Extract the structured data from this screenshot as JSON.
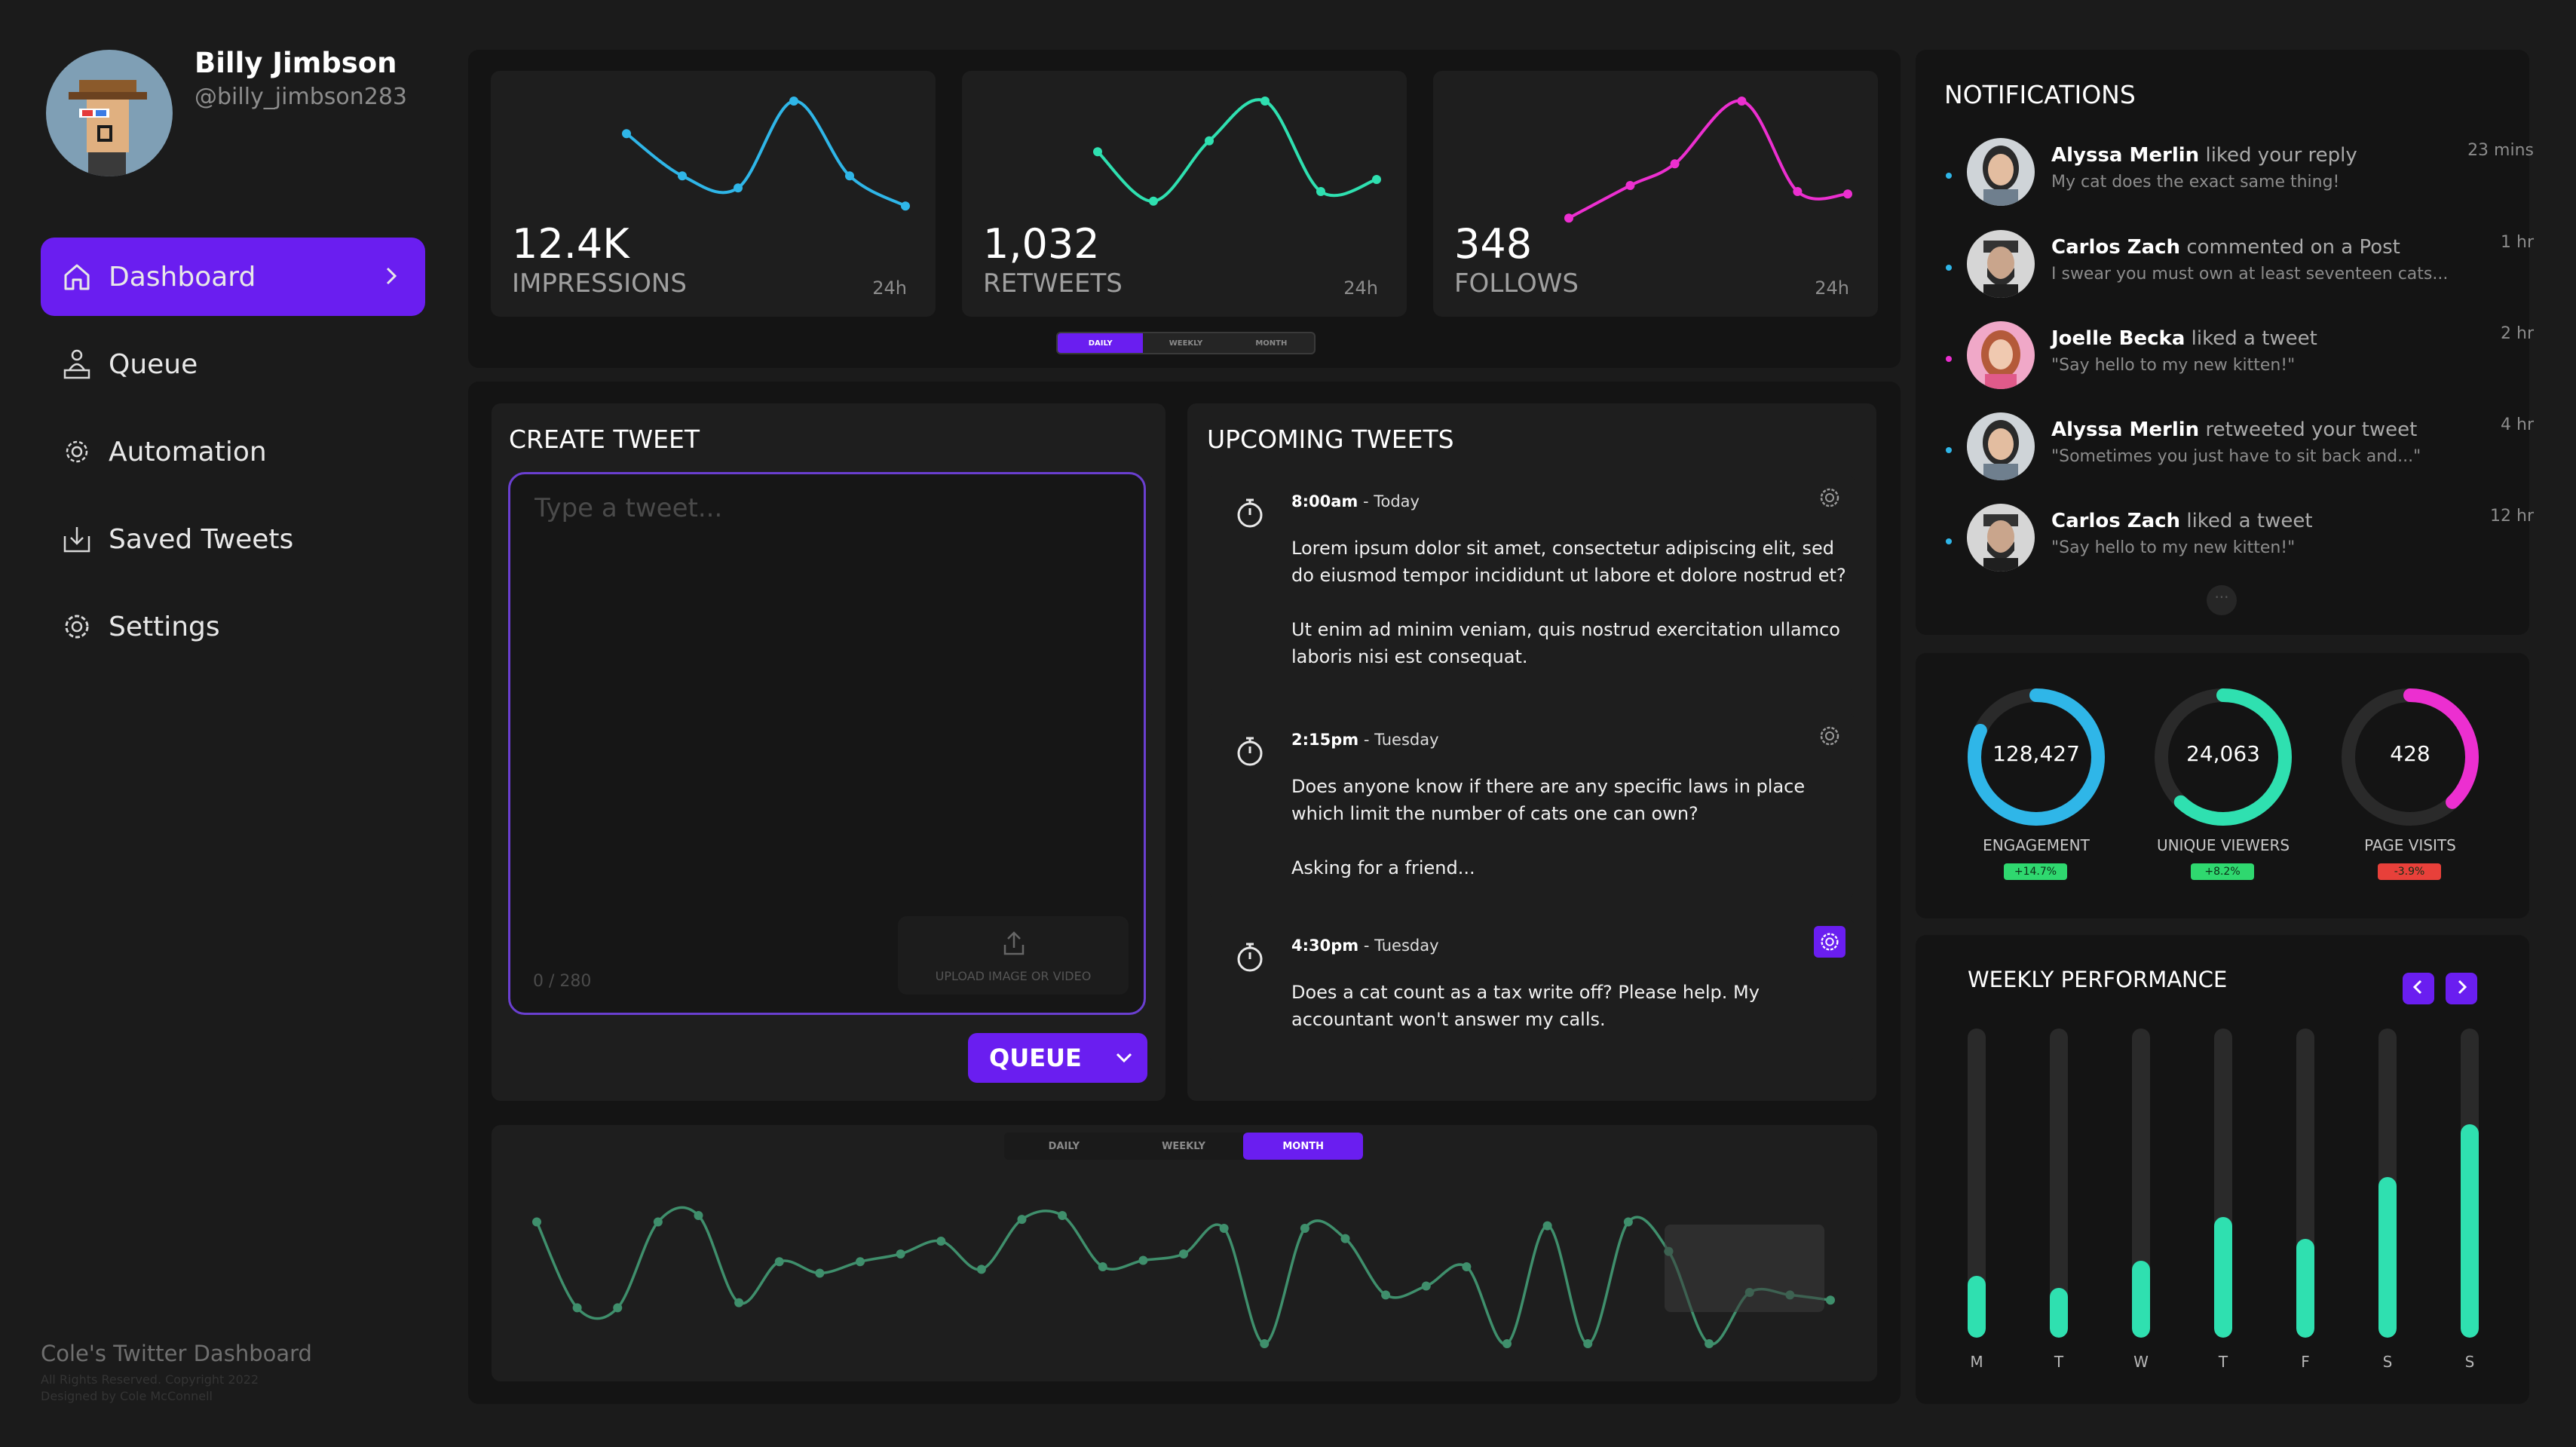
{
  "profile": {
    "name": "Billy Jimbson",
    "handle": "@billy_jimbson283"
  },
  "nav": {
    "items": [
      {
        "label": "Dashboard",
        "icon": "home-icon",
        "active": true
      },
      {
        "label": "Queue",
        "icon": "queue-person-icon"
      },
      {
        "label": "Automation",
        "icon": "automation-gear-icon"
      },
      {
        "label": "Saved Tweets",
        "icon": "download-tray-icon"
      },
      {
        "label": "Settings",
        "icon": "gear-icon"
      }
    ]
  },
  "footer": {
    "title": "Cole's Twitter Dashboard",
    "rights": "All Rights Reserved. Copyright 2022",
    "designer": "Designed by Cole McConnell"
  },
  "stats": [
    {
      "value": "12.4K",
      "label": "IMPRESSIONS",
      "period": "24h",
      "color": "#2fb6e8",
      "points": [
        [
          0.0,
          0.27
        ],
        [
          0.2,
          0.62
        ],
        [
          0.4,
          0.72
        ],
        [
          0.6,
          0.0
        ],
        [
          0.8,
          0.62
        ],
        [
          1.0,
          0.87
        ]
      ]
    },
    {
      "value": "1,032",
      "label": "RETWEETS",
      "period": "24h",
      "color": "#2fe0b0",
      "points": [
        [
          0.0,
          0.42
        ],
        [
          0.2,
          0.83
        ],
        [
          0.4,
          0.33
        ],
        [
          0.6,
          0.0
        ],
        [
          0.8,
          0.75
        ],
        [
          1.0,
          0.65
        ]
      ]
    },
    {
      "value": "348",
      "label": "FOLLOWS",
      "period": "24h",
      "color": "#ec2fd0",
      "points": [
        [
          0.0,
          0.97
        ],
        [
          0.22,
          0.7
        ],
        [
          0.38,
          0.52
        ],
        [
          0.62,
          0.0
        ],
        [
          0.82,
          0.75
        ],
        [
          1.0,
          0.77
        ]
      ]
    }
  ],
  "stats_tabs": {
    "items": [
      "DAILY",
      "WEEKLY",
      "MONTH"
    ],
    "active": 0
  },
  "create_tweet": {
    "title": "CREATE TWEET",
    "placeholder": "Type a tweet...",
    "char_count": "0 / 280",
    "upload_label": "UPLOAD IMAGE OR VIDEO",
    "queue_label": "QUEUE"
  },
  "upcoming": {
    "title": "UPCOMING TWEETS",
    "tweets": [
      {
        "time": "8:00am",
        "day": " - Today",
        "paragraphs": [
          "Lorem ipsum dolor sit amet, consectetur adipiscing elit, sed do eiusmod tempor incididunt ut labore et dolore nostrud et?",
          "Ut enim ad minim veniam, quis nostrud exercitation ullamco laboris nisi est consequat."
        ]
      },
      {
        "time": "2:15pm",
        "day": " - Tuesday",
        "paragraphs": [
          "Does anyone know if there are any specific laws in place which limit the number of cats one can own?",
          "Asking for a friend..."
        ]
      },
      {
        "time": "4:30pm",
        "day": " - Tuesday",
        "paragraphs": [
          "Does a cat count as a tax write off? Please help. My accountant won't answer my calls."
        ]
      }
    ]
  },
  "timeline": {
    "tabs": [
      "DAILY",
      "WEEKLY",
      "MONTH"
    ],
    "active": 2,
    "color": "#3f8f6c",
    "points": [
      0.05,
      0.72,
      0.72,
      0.05,
      0.0,
      0.68,
      0.36,
      0.45,
      0.36,
      0.3,
      0.2,
      0.42,
      0.03,
      0.0,
      0.4,
      0.35,
      0.3,
      0.1,
      1.0,
      0.1,
      0.18,
      0.62,
      0.55,
      0.4,
      1.0,
      0.08,
      1.0,
      0.05,
      0.28,
      1.0,
      0.6,
      0.62,
      0.66
    ]
  },
  "notifications": {
    "title": "NOTIFICATIONS",
    "items": [
      {
        "name": "Alyssa Merlin",
        "action": " liked your reply",
        "text": "My cat does the exact same thing!",
        "time": "23 mins",
        "dot": "#2fb6e8"
      },
      {
        "name": "Carlos Zach",
        "action": " commented on a Post",
        "text": "I swear you must own at least seventeen cats...",
        "time": "1 hr",
        "dot": "#2fb6e8"
      },
      {
        "name": "Joelle Becka",
        "action": " liked a tweet",
        "text": "\"Say hello to my new kitten!\"",
        "time": "2 hr",
        "dot": "#ec2fd0"
      },
      {
        "name": "Alyssa Merlin",
        "action": " retweeted your tweet",
        "text": "\"Sometimes you just have to sit back and...\"",
        "time": "4 hr",
        "dot": "#2fb6e8"
      },
      {
        "name": "Carlos Zach",
        "action": " liked a tweet",
        "text": "\"Say hello to my new kitten!\"",
        "time": "12 hr",
        "dot": "#2fb6e8"
      }
    ]
  },
  "rings": [
    {
      "value": "128,427",
      "label": "ENGAGEMENT",
      "delta": "+14.7%",
      "fraction": 0.82,
      "color": "#2fb6e8",
      "badge": "#2fd86f"
    },
    {
      "value": "24,063",
      "label": "UNIQUE VIEWERS",
      "delta": "+8.2%",
      "fraction": 0.62,
      "color": "#2fe0b0",
      "badge": "#2fd86f"
    },
    {
      "value": "428",
      "label": "PAGE VISITS",
      "delta": "-3.9%",
      "fraction": 0.38,
      "color": "#ec2fd0",
      "badge": "#e8403a"
    }
  ],
  "weekly": {
    "title": "WEEKLY PERFORMANCE",
    "days": [
      "M",
      "T",
      "W",
      "T",
      "F",
      "S",
      "S"
    ],
    "values": [
      0.2,
      0.16,
      0.25,
      0.39,
      0.32,
      0.52,
      0.69
    ]
  }
}
